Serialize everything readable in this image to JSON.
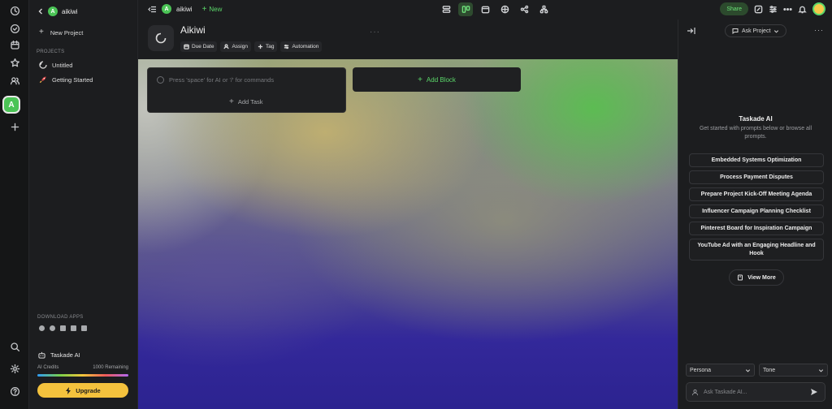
{
  "workspace": {
    "initial": "A",
    "name": "aikiwi"
  },
  "sidebar": {
    "new_project": "New Project",
    "projects_label": "PROJECTS",
    "projects": [
      {
        "label": "Untitled",
        "icon": "project-icon"
      },
      {
        "label": "Getting Started",
        "icon": "rocket-icon"
      }
    ],
    "download_label": "DOWNLOAD APPS",
    "ai_label": "Taskade AI",
    "credits_label": "AI Credits",
    "credits_remaining": "1000 Remaining",
    "upgrade_label": "Upgrade"
  },
  "topbar": {
    "new_label": "New",
    "share_label": "Share"
  },
  "project": {
    "title": "Aikiwi",
    "actions": [
      "Due Date",
      "Assign",
      "Tag",
      "Automation"
    ]
  },
  "canvas": {
    "task_placeholder": "Press 'space' for AI or '/' for commands",
    "add_task": "Add Task",
    "add_block": "Add Block"
  },
  "ai_panel": {
    "ask_project": "Ask Project",
    "title": "Taskade AI",
    "subtitle": "Get started with prompts below or browse all prompts.",
    "prompts": [
      "Embedded Systems Optimization",
      "Process Payment Disputes",
      "Prepare Project Kick-Off Meeting Agenda",
      "Influencer Campaign Planning Checklist",
      "Pinterest Board for Inspiration Campaign",
      "YouTube Ad with an Engaging Headline and Hook"
    ],
    "view_more": "View More",
    "persona": "Persona",
    "tone": "Tone",
    "input_placeholder": "Ask Taskade AI..."
  },
  "colors": {
    "accent": "#5bd76a",
    "upgrade": "#f4c23d"
  }
}
